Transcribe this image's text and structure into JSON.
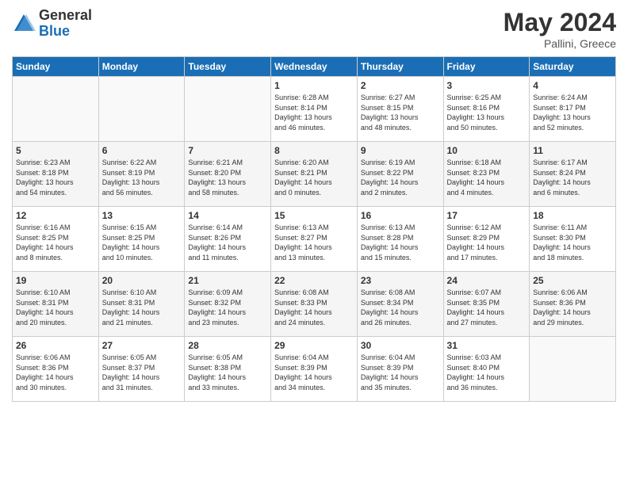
{
  "header": {
    "logo_general": "General",
    "logo_blue": "Blue",
    "title": "May 2024",
    "location": "Pallini, Greece"
  },
  "weekdays": [
    "Sunday",
    "Monday",
    "Tuesday",
    "Wednesday",
    "Thursday",
    "Friday",
    "Saturday"
  ],
  "weeks": [
    [
      {
        "day": "",
        "info": ""
      },
      {
        "day": "",
        "info": ""
      },
      {
        "day": "",
        "info": ""
      },
      {
        "day": "1",
        "info": "Sunrise: 6:28 AM\nSunset: 8:14 PM\nDaylight: 13 hours\nand 46 minutes."
      },
      {
        "day": "2",
        "info": "Sunrise: 6:27 AM\nSunset: 8:15 PM\nDaylight: 13 hours\nand 48 minutes."
      },
      {
        "day": "3",
        "info": "Sunrise: 6:25 AM\nSunset: 8:16 PM\nDaylight: 13 hours\nand 50 minutes."
      },
      {
        "day": "4",
        "info": "Sunrise: 6:24 AM\nSunset: 8:17 PM\nDaylight: 13 hours\nand 52 minutes."
      }
    ],
    [
      {
        "day": "5",
        "info": "Sunrise: 6:23 AM\nSunset: 8:18 PM\nDaylight: 13 hours\nand 54 minutes."
      },
      {
        "day": "6",
        "info": "Sunrise: 6:22 AM\nSunset: 8:19 PM\nDaylight: 13 hours\nand 56 minutes."
      },
      {
        "day": "7",
        "info": "Sunrise: 6:21 AM\nSunset: 8:20 PM\nDaylight: 13 hours\nand 58 minutes."
      },
      {
        "day": "8",
        "info": "Sunrise: 6:20 AM\nSunset: 8:21 PM\nDaylight: 14 hours\nand 0 minutes."
      },
      {
        "day": "9",
        "info": "Sunrise: 6:19 AM\nSunset: 8:22 PM\nDaylight: 14 hours\nand 2 minutes."
      },
      {
        "day": "10",
        "info": "Sunrise: 6:18 AM\nSunset: 8:23 PM\nDaylight: 14 hours\nand 4 minutes."
      },
      {
        "day": "11",
        "info": "Sunrise: 6:17 AM\nSunset: 8:24 PM\nDaylight: 14 hours\nand 6 minutes."
      }
    ],
    [
      {
        "day": "12",
        "info": "Sunrise: 6:16 AM\nSunset: 8:25 PM\nDaylight: 14 hours\nand 8 minutes."
      },
      {
        "day": "13",
        "info": "Sunrise: 6:15 AM\nSunset: 8:25 PM\nDaylight: 14 hours\nand 10 minutes."
      },
      {
        "day": "14",
        "info": "Sunrise: 6:14 AM\nSunset: 8:26 PM\nDaylight: 14 hours\nand 11 minutes."
      },
      {
        "day": "15",
        "info": "Sunrise: 6:13 AM\nSunset: 8:27 PM\nDaylight: 14 hours\nand 13 minutes."
      },
      {
        "day": "16",
        "info": "Sunrise: 6:13 AM\nSunset: 8:28 PM\nDaylight: 14 hours\nand 15 minutes."
      },
      {
        "day": "17",
        "info": "Sunrise: 6:12 AM\nSunset: 8:29 PM\nDaylight: 14 hours\nand 17 minutes."
      },
      {
        "day": "18",
        "info": "Sunrise: 6:11 AM\nSunset: 8:30 PM\nDaylight: 14 hours\nand 18 minutes."
      }
    ],
    [
      {
        "day": "19",
        "info": "Sunrise: 6:10 AM\nSunset: 8:31 PM\nDaylight: 14 hours\nand 20 minutes."
      },
      {
        "day": "20",
        "info": "Sunrise: 6:10 AM\nSunset: 8:31 PM\nDaylight: 14 hours\nand 21 minutes."
      },
      {
        "day": "21",
        "info": "Sunrise: 6:09 AM\nSunset: 8:32 PM\nDaylight: 14 hours\nand 23 minutes."
      },
      {
        "day": "22",
        "info": "Sunrise: 6:08 AM\nSunset: 8:33 PM\nDaylight: 14 hours\nand 24 minutes."
      },
      {
        "day": "23",
        "info": "Sunrise: 6:08 AM\nSunset: 8:34 PM\nDaylight: 14 hours\nand 26 minutes."
      },
      {
        "day": "24",
        "info": "Sunrise: 6:07 AM\nSunset: 8:35 PM\nDaylight: 14 hours\nand 27 minutes."
      },
      {
        "day": "25",
        "info": "Sunrise: 6:06 AM\nSunset: 8:36 PM\nDaylight: 14 hours\nand 29 minutes."
      }
    ],
    [
      {
        "day": "26",
        "info": "Sunrise: 6:06 AM\nSunset: 8:36 PM\nDaylight: 14 hours\nand 30 minutes."
      },
      {
        "day": "27",
        "info": "Sunrise: 6:05 AM\nSunset: 8:37 PM\nDaylight: 14 hours\nand 31 minutes."
      },
      {
        "day": "28",
        "info": "Sunrise: 6:05 AM\nSunset: 8:38 PM\nDaylight: 14 hours\nand 33 minutes."
      },
      {
        "day": "29",
        "info": "Sunrise: 6:04 AM\nSunset: 8:39 PM\nDaylight: 14 hours\nand 34 minutes."
      },
      {
        "day": "30",
        "info": "Sunrise: 6:04 AM\nSunset: 8:39 PM\nDaylight: 14 hours\nand 35 minutes."
      },
      {
        "day": "31",
        "info": "Sunrise: 6:03 AM\nSunset: 8:40 PM\nDaylight: 14 hours\nand 36 minutes."
      },
      {
        "day": "",
        "info": ""
      }
    ]
  ]
}
